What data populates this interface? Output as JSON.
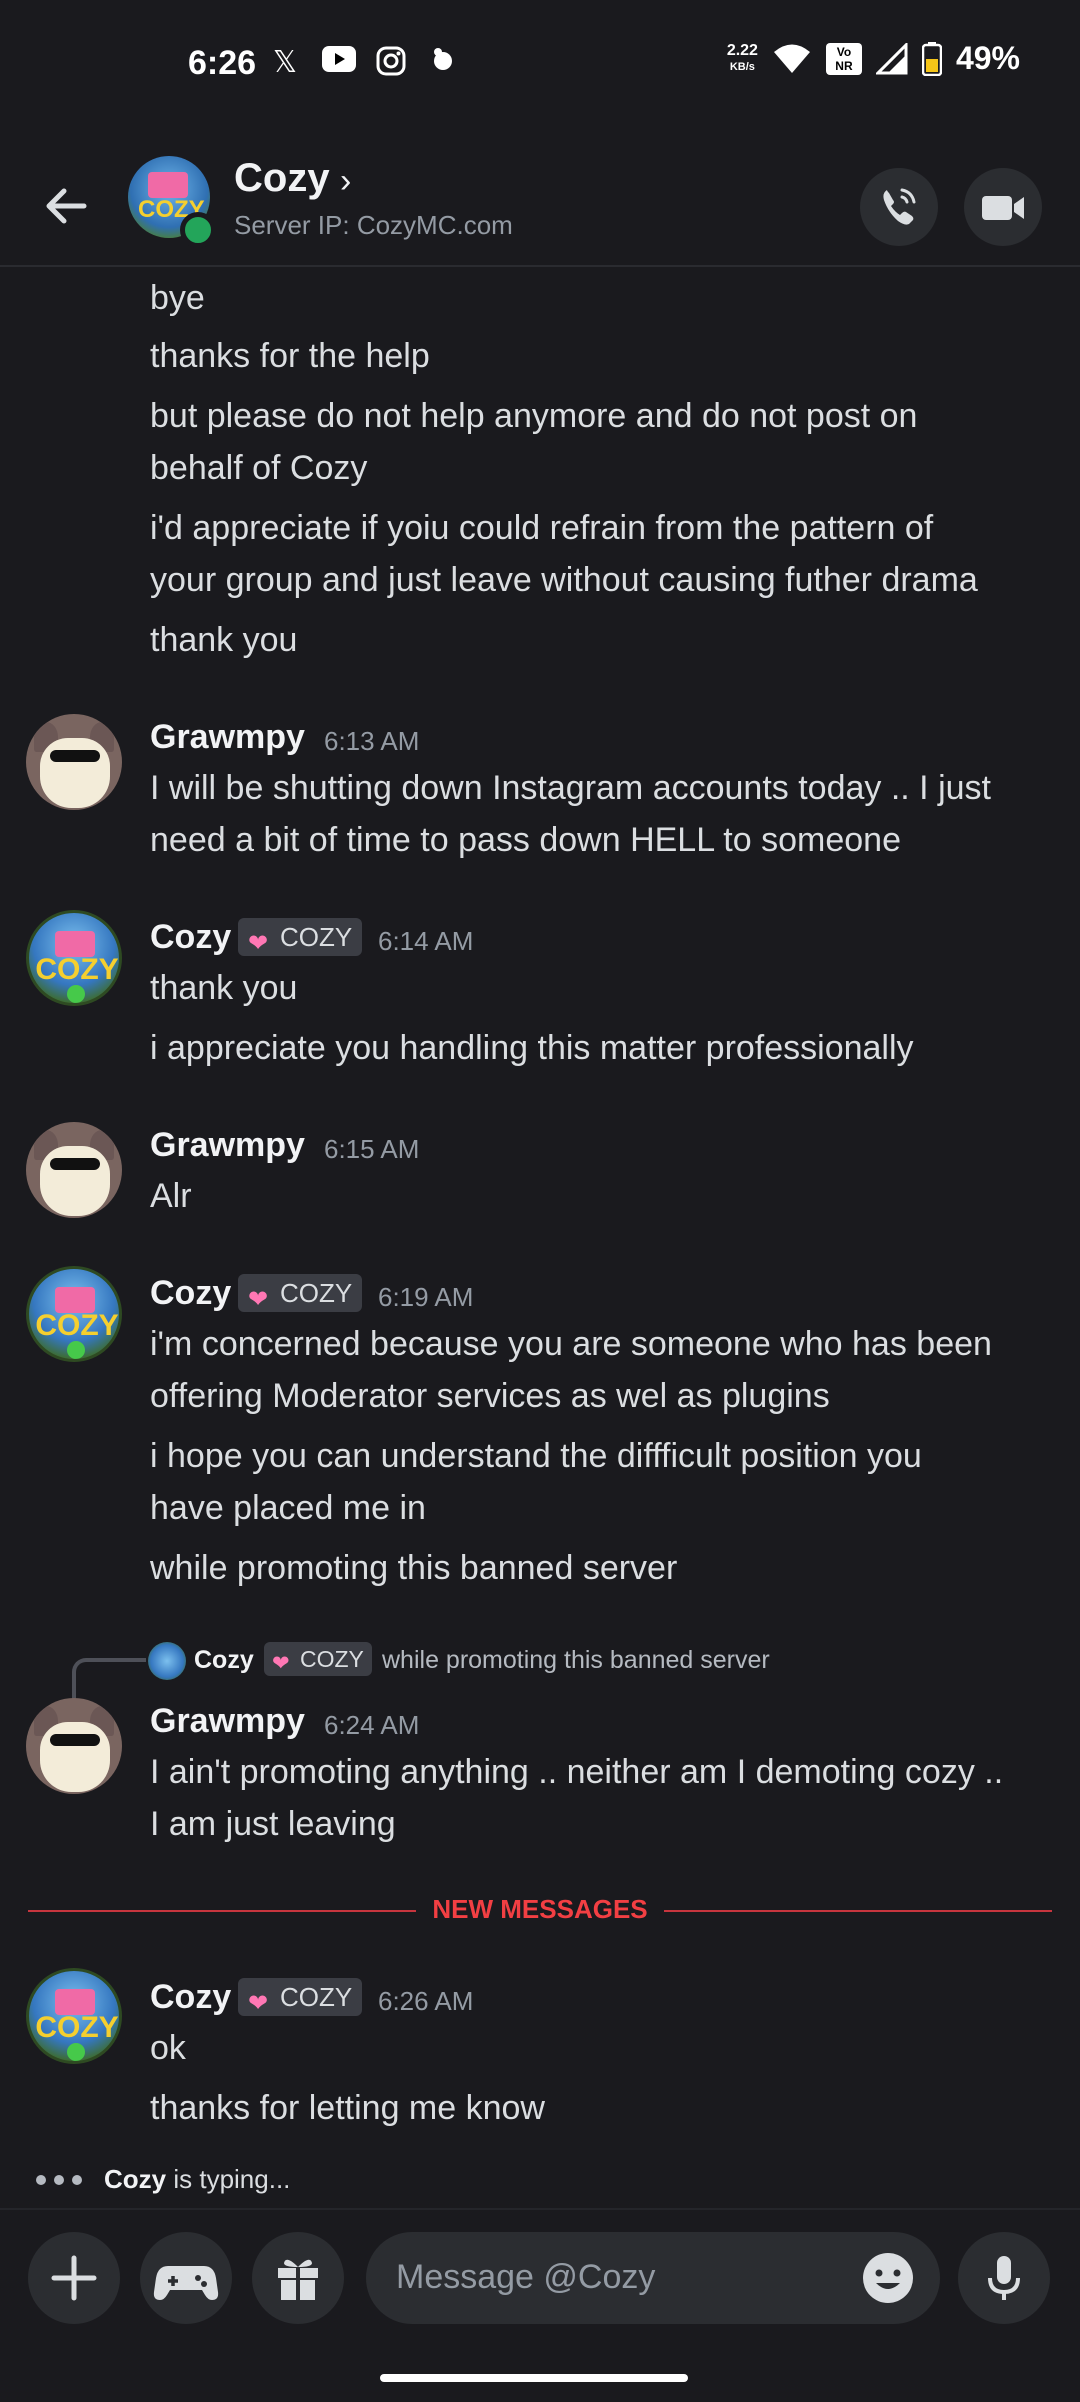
{
  "status_bar": {
    "time": "6:26",
    "speed_value": "2.22",
    "speed_unit": "KB/s",
    "volte_top": "Vo",
    "volte_bottom": "NR",
    "battery": "49%"
  },
  "header": {
    "name": "Cozy",
    "subtitle": "Server IP: CozyMC.com",
    "avatar_text": "COZY"
  },
  "messages": {
    "earlier_lines": [
      "bye",
      "thanks for the help",
      "but please do not help anymore and do not post on",
      "behalf of Cozy",
      "i'd appreciate if yoiu could refrain from the pattern of",
      "your group and just leave without causing futher drama",
      "thank you"
    ],
    "m1": {
      "author": "Grawmpy",
      "time": "6:13 AM",
      "lines": [
        "I will be shutting down Instagram accounts today .. I just",
        "need a bit of time to pass down HELL to someone"
      ]
    },
    "m2": {
      "author": "Cozy",
      "badge": "COZY",
      "time": "6:14 AM",
      "lines": [
        "thank you",
        "i appreciate you handling this matter professionally"
      ]
    },
    "m3": {
      "author": "Grawmpy",
      "time": "6:15 AM",
      "lines": [
        "Alr"
      ]
    },
    "m4": {
      "author": "Cozy",
      "badge": "COZY",
      "time": "6:19 AM",
      "lines": [
        "i'm concerned because you are someone who has been",
        "offering Moderator services as wel as plugins",
        "i hope you can understand the diffficult position you",
        "have placed me in",
        "while promoting this banned server"
      ]
    },
    "reply": {
      "author": "Cozy",
      "badge": "COZY",
      "text": "while promoting this banned server"
    },
    "m5": {
      "author": "Grawmpy",
      "time": "6:24 AM",
      "lines": [
        "I ain't promoting anything .. neither am I demoting cozy ..",
        "I am just leaving"
      ]
    },
    "new_messages_label": "NEW MESSAGES",
    "m6": {
      "author": "Cozy",
      "badge": "COZY",
      "time": "6:26 AM",
      "lines": [
        "ok",
        "thanks for letting me know"
      ]
    }
  },
  "typing": {
    "user": "Cozy",
    "text": " is typing..."
  },
  "composer": {
    "placeholder": "Message @Cozy"
  },
  "icons": {
    "back": "arrow-left-icon",
    "call": "phone-icon",
    "video": "video-camera-icon",
    "plus": "plus-icon",
    "game": "gamepad-icon",
    "gift": "gift-icon",
    "emoji": "emoji-icon",
    "mic": "microphone-icon"
  },
  "colors": {
    "background": "#1a1a1e",
    "online": "#23a55a",
    "new_messages": "#f23f43",
    "badge_heart": "#ff77b4"
  }
}
